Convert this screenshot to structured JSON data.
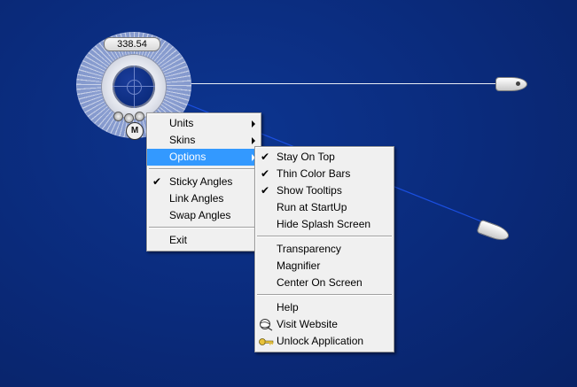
{
  "widget": {
    "readout": "338.54",
    "logo_glyph": "M"
  },
  "context_menu": {
    "items": [
      {
        "label": "Units",
        "submenu": true
      },
      {
        "label": "Skins",
        "submenu": true
      },
      {
        "label": "Options",
        "submenu": true,
        "highlighted": true
      },
      {
        "separator": true
      },
      {
        "label": "Sticky Angles",
        "checked": true
      },
      {
        "label": "Link Angles"
      },
      {
        "label": "Swap Angles"
      },
      {
        "separator": true
      },
      {
        "label": "Exit"
      }
    ]
  },
  "options_submenu": {
    "items": [
      {
        "label": "Stay On Top",
        "checked": true
      },
      {
        "label": "Thin Color Bars",
        "checked": true
      },
      {
        "label": "Show Tooltips",
        "checked": true
      },
      {
        "label": "Run at StartUp"
      },
      {
        "label": "Hide Splash Screen"
      },
      {
        "separator": true
      },
      {
        "label": "Transparency"
      },
      {
        "label": "Magnifier"
      },
      {
        "label": "Center On Screen"
      },
      {
        "separator": true
      },
      {
        "label": "Help"
      },
      {
        "label": "Visit Website",
        "icon": "globe-icon"
      },
      {
        "label": "Unlock Application",
        "icon": "key-icon"
      }
    ]
  },
  "colors": {
    "desktop_bg": "#0a2a7a",
    "menu_bg": "#f0f0f0",
    "highlight": "#3399ff"
  }
}
